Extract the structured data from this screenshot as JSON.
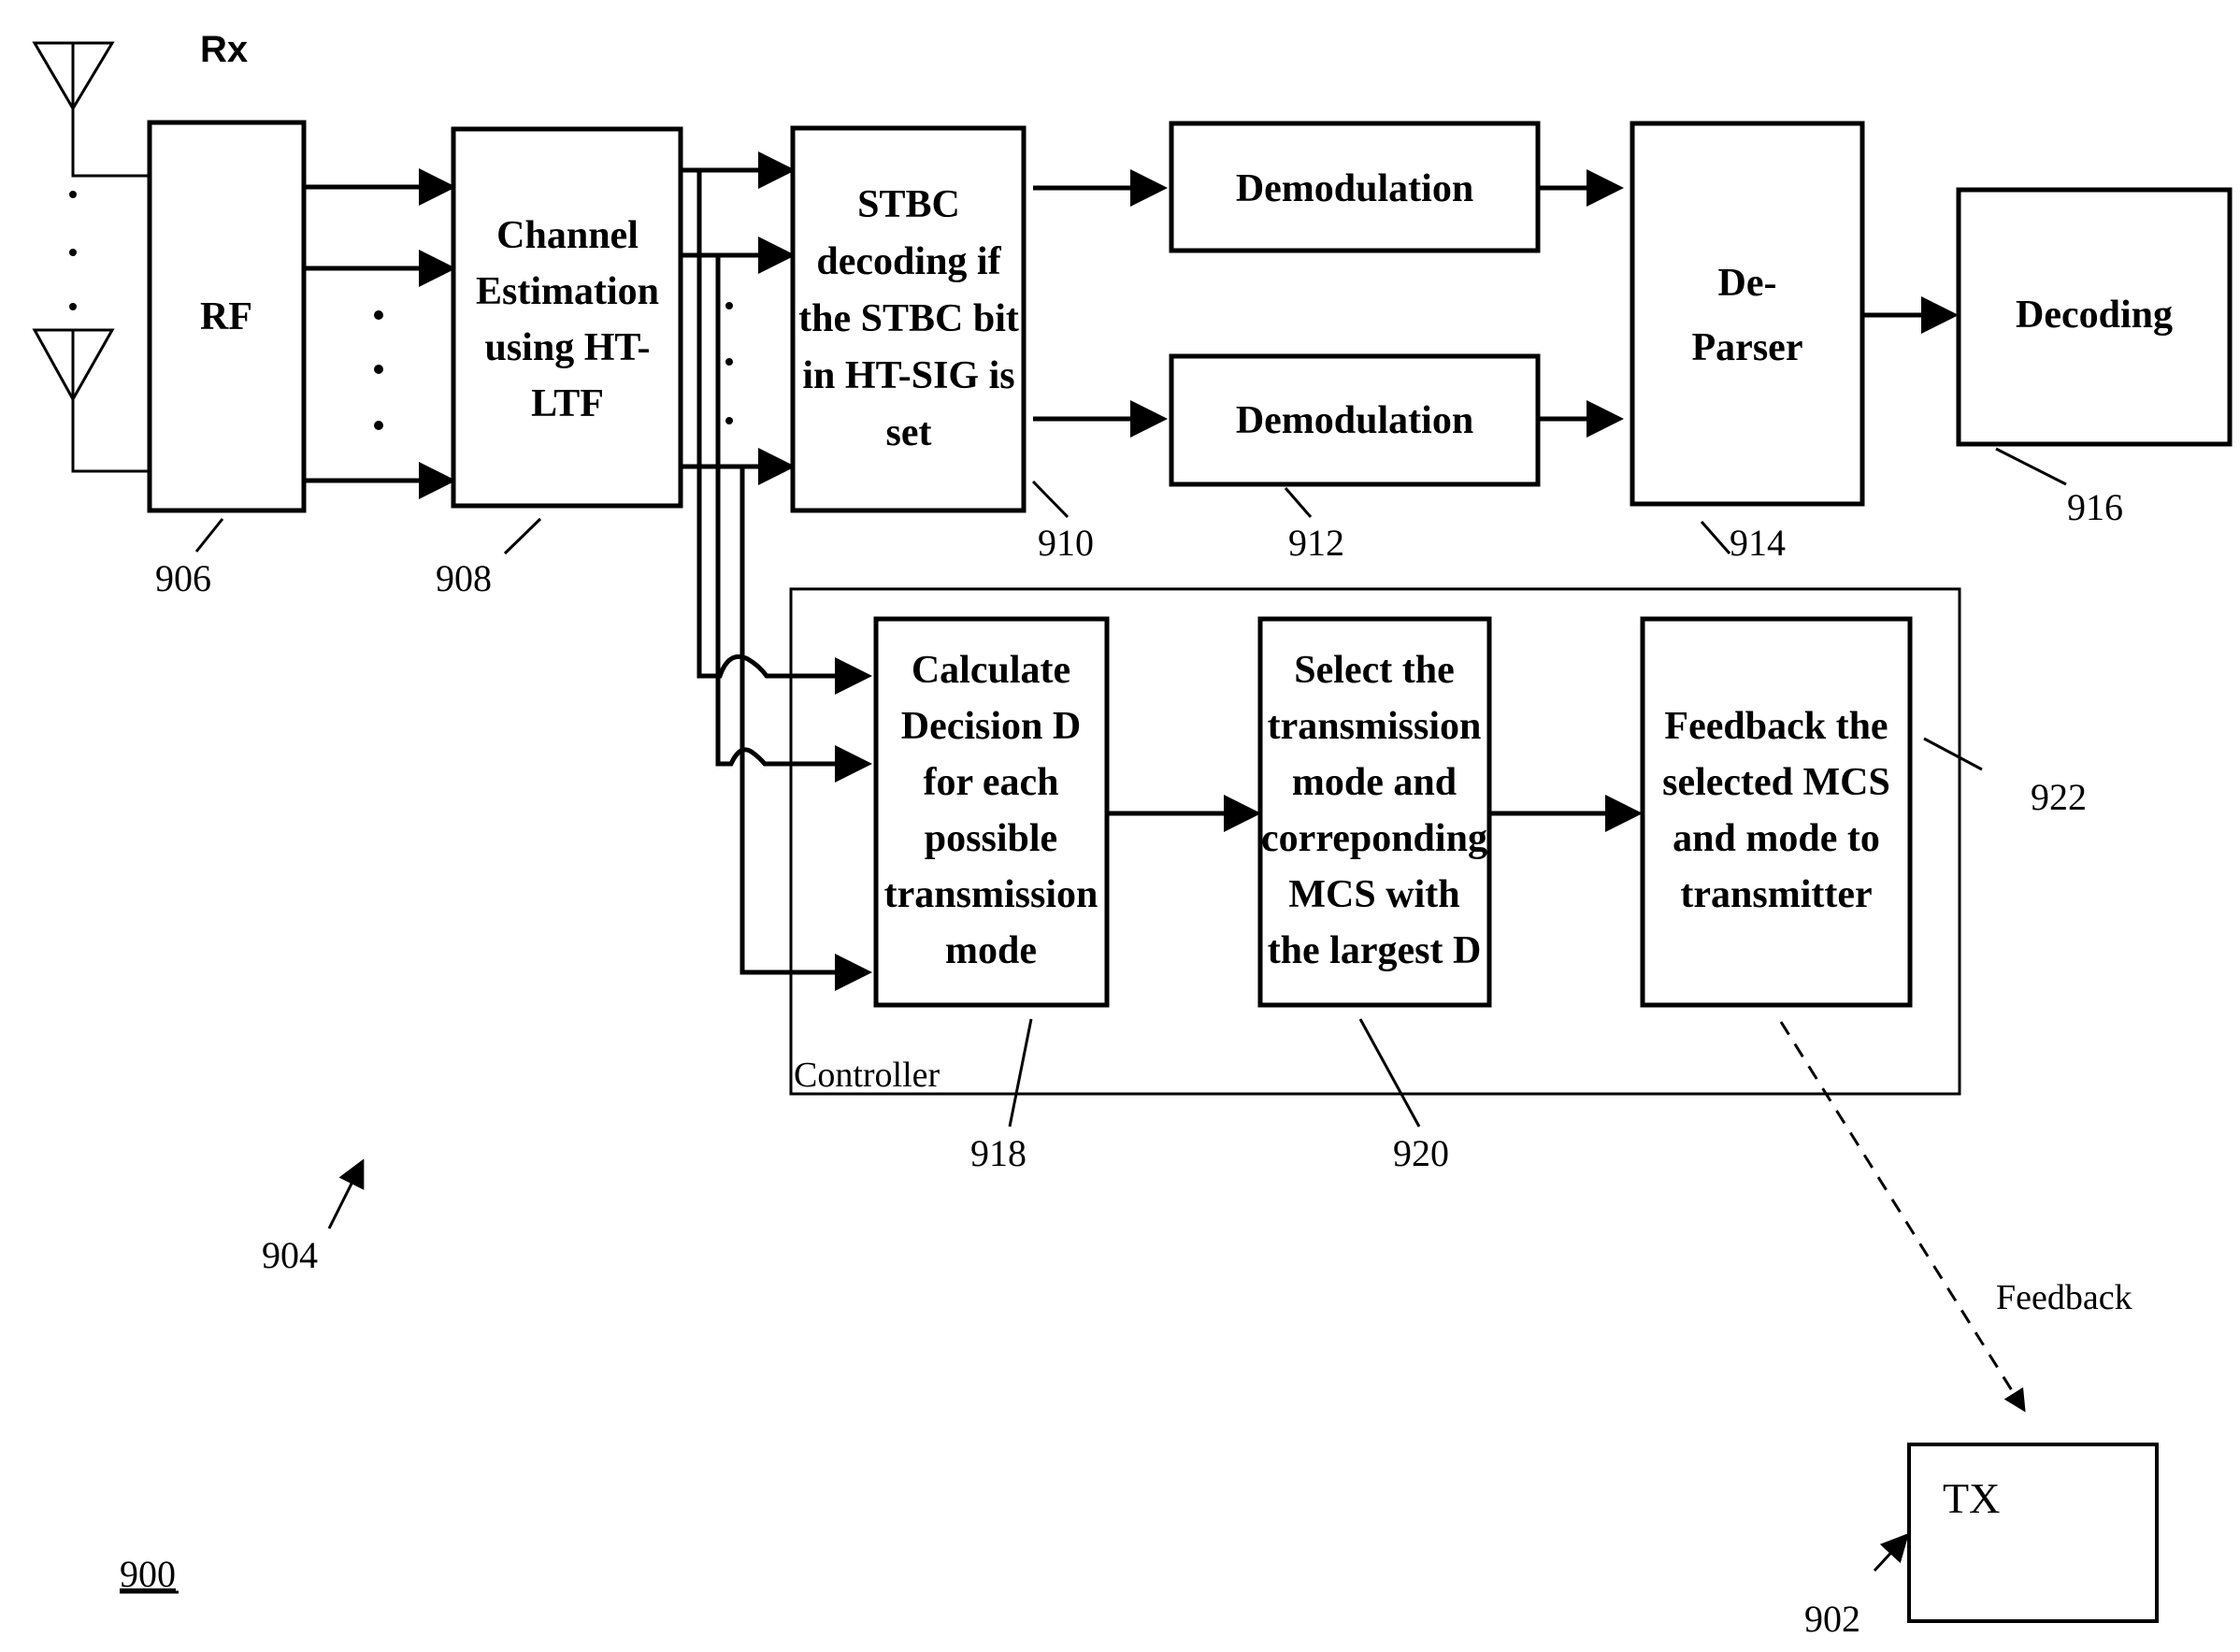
{
  "figure": {
    "id_label": "900",
    "receiver_label": "Rx",
    "receiver_ref": "904"
  },
  "blocks": {
    "rf": {
      "lines": [
        "RF"
      ],
      "ref": "906"
    },
    "channel_estimation": {
      "lines": [
        "Channel",
        "Estimation",
        "using HT-",
        "LTF"
      ],
      "ref": "908"
    },
    "stbc": {
      "lines": [
        "STBC",
        "decoding if",
        "the STBC bit",
        "in HT-SIG is",
        "set"
      ],
      "ref": "910"
    },
    "demod1": {
      "lines": [
        "Demodulation"
      ]
    },
    "demod2": {
      "lines": [
        "Demodulation"
      ],
      "ref": "912"
    },
    "deparser": {
      "lines": [
        "De-",
        "Parser"
      ],
      "ref": "914"
    },
    "decoding": {
      "lines": [
        "Decoding"
      ],
      "ref": "916"
    },
    "calc": {
      "lines": [
        "Calculate",
        "Decision D",
        "for each",
        "possible",
        "transmission",
        "mode"
      ],
      "ref": "918"
    },
    "select": {
      "lines": [
        "Select the",
        "transmission",
        "mode and",
        "correponding",
        "MCS with",
        "the largest D"
      ],
      "ref": "920"
    },
    "feedback": {
      "lines": [
        "Feedback the",
        "selected MCS",
        "and mode to",
        "transmitter"
      ],
      "ref": "922"
    },
    "tx": {
      "lines": [
        "TX"
      ],
      "ref": "902"
    }
  },
  "controller": {
    "label": "Controller"
  },
  "feedback_link": {
    "label": "Feedback"
  }
}
